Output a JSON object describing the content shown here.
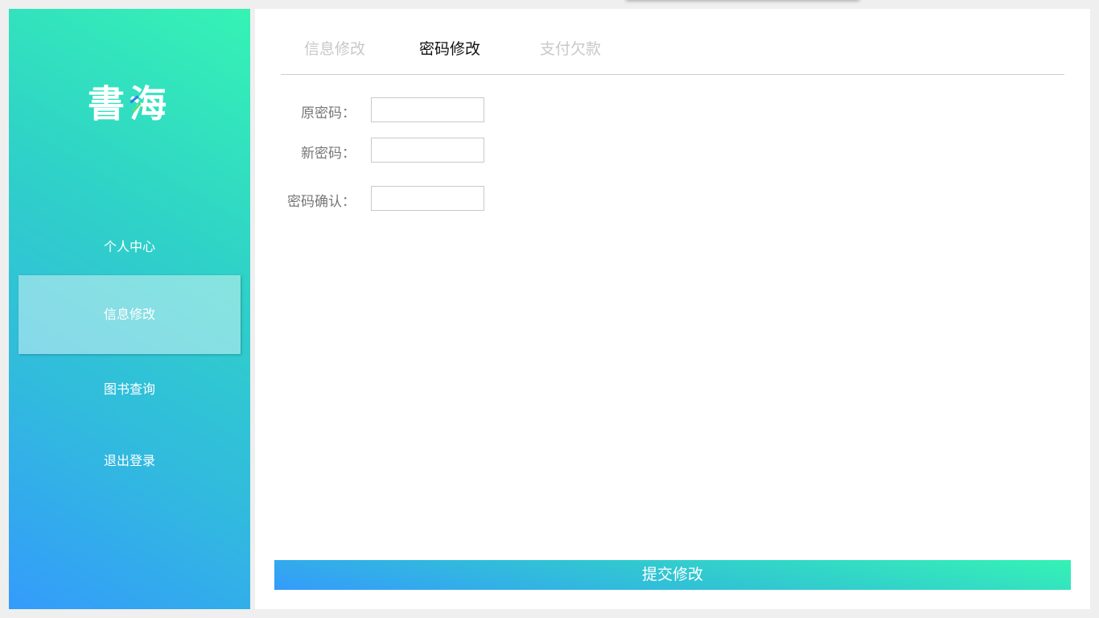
{
  "sidebar": {
    "logo": {
      "char1": "書",
      "char2": "海"
    },
    "items": [
      {
        "label": "个人中心"
      },
      {
        "label": "信息修改"
      },
      {
        "label": "图书查询"
      },
      {
        "label": "退出登录"
      }
    ],
    "active_item": "信息修改"
  },
  "main": {
    "tabs": [
      {
        "label": "信息修改"
      },
      {
        "label": "密码修改"
      },
      {
        "label": "支付欠款"
      }
    ],
    "active_tab": "密码修改",
    "form": {
      "old_password": {
        "label": "原密码：",
        "value": ""
      },
      "new_password": {
        "label": "新密码：",
        "value": ""
      },
      "confirm_password": {
        "label": "密码确认：",
        "value": ""
      }
    },
    "submit_label": "提交修改"
  },
  "colors": {
    "gradient_start": "#35f3b4",
    "gradient_end": "#349bfb",
    "tab_inactive": "#c8c8c8",
    "tab_active": "#111111",
    "label_text": "#777777"
  }
}
